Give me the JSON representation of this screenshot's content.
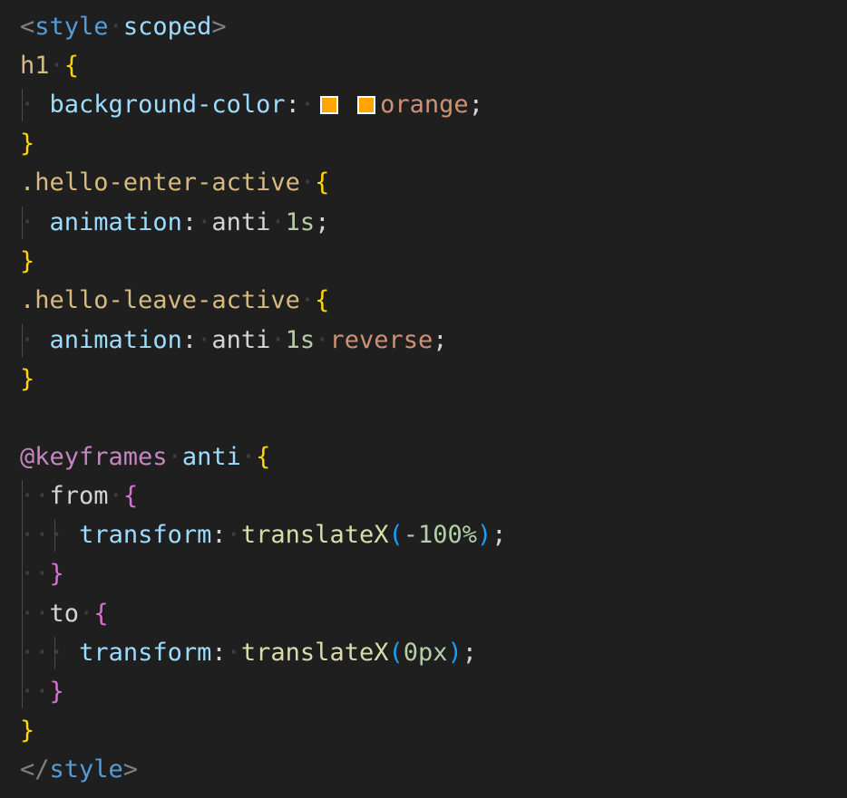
{
  "theme": {
    "background": "#1f1f1f",
    "colors": {
      "punct_tag": "#808080",
      "tag": "#569cd6",
      "attr": "#9cdcfe",
      "selector": "#d7ba7d",
      "brace_outer": "#ffd700",
      "brace_inner": "#da70d6",
      "paren": "#179fff",
      "value_string": "#ce9178",
      "number": "#b5cea8",
      "function": "#dcdcaa",
      "at_rule": "#c586c0",
      "default": "#d4d4d4",
      "whitespace_dot": "#3f3f3f",
      "swatch_orange": "#ffa500"
    }
  },
  "code": {
    "open_tag_lt": "<",
    "open_tag_name": "style",
    "open_tag_attr": "scoped",
    "open_tag_gt": ">",
    "h1_selector": "h1",
    "bg_property": "background-color",
    "bg_value": "orange",
    "enter_selector": ".hello-enter-active",
    "leave_selector": ".hello-leave-active",
    "animation_property": "animation",
    "anim_name": "anti",
    "anim_duration": "1s",
    "anim_direction": "reverse",
    "keyframes_rule": "@keyframes",
    "keyframes_name": "anti",
    "from_selector": "from",
    "to_selector": "to",
    "transform_property": "transform",
    "translate_fn": "translateX",
    "from_value": "-100%",
    "to_value": "0px",
    "close_tag_lt": "</",
    "close_tag_name": "style",
    "close_tag_gt": ">",
    "brace_open": "{",
    "brace_close": "}",
    "colon": ":",
    "semicolon": ";",
    "paren_open": "(",
    "paren_close": ")"
  }
}
